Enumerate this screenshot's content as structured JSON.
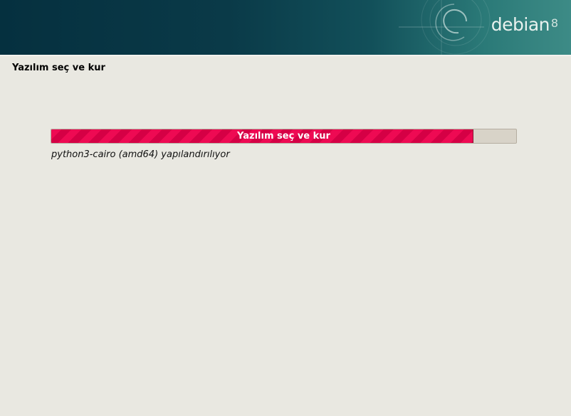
{
  "header": {
    "logo_text": "debian",
    "logo_version": "8",
    "colors": {
      "banner_dark": "#05303f",
      "banner_light": "#3d8b86"
    }
  },
  "page": {
    "title": "Yazılım seç ve kur"
  },
  "progress": {
    "label": "Yazılım seç ve kur",
    "fraction": 0.908,
    "status": "python3-cairo (amd64) yapılandırılıyor",
    "colors": {
      "fill": "#ee0a53",
      "track": "#d8d3c8"
    }
  }
}
